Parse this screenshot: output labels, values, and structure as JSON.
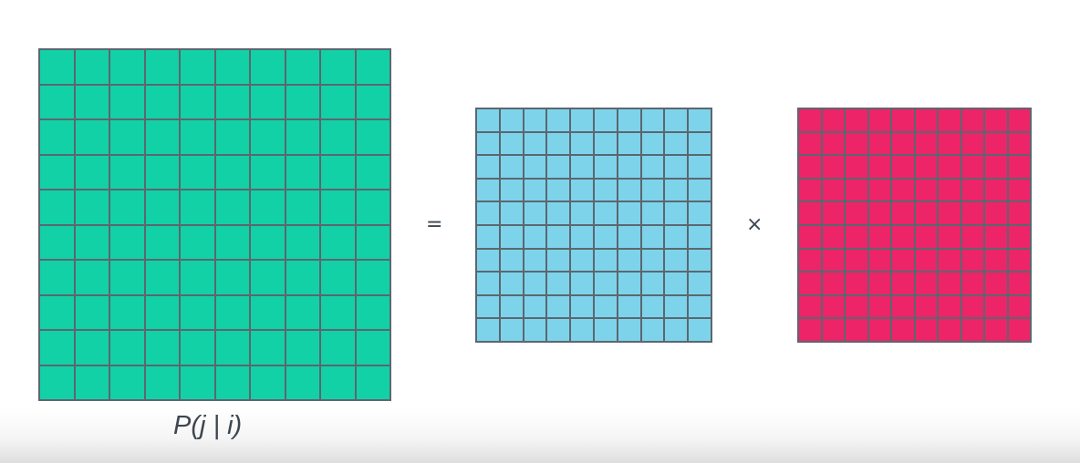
{
  "colors": {
    "background": "#ffffff",
    "grid_lines": "#5c6670",
    "operator_text": "#3d4650",
    "caption_text": "#3d4650"
  },
  "result_matrix": {
    "rows": 10,
    "cols": 10,
    "fill": "#12d1a6"
  },
  "left_factor": {
    "rows": 10,
    "cols": 10,
    "fill": "#7dd4ea"
  },
  "right_factor": {
    "rows": 10,
    "cols": 10,
    "fill": "#ee2468"
  },
  "operators": {
    "equals": "=",
    "times": "×"
  },
  "caption": "P(j | i)"
}
